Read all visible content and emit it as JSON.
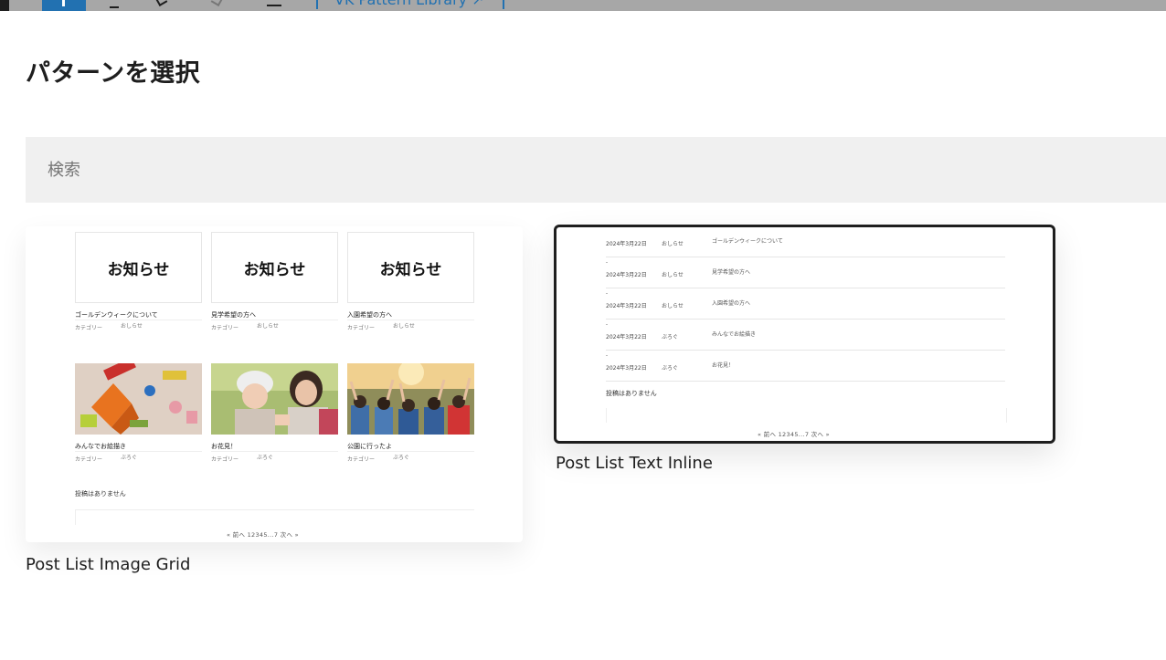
{
  "toolbar": {
    "tab_label": "VK Pattern Library ↗"
  },
  "modal": {
    "title": "パターンを選択"
  },
  "search": {
    "placeholder": "検索"
  },
  "patterns": [
    {
      "label": "Post List Image Grid",
      "thumb_text": "お知らせ",
      "items": [
        {
          "title": "ゴールデンウィークについて",
          "meta_key": "カテゴリー",
          "meta_val": "おしらせ"
        },
        {
          "title": "見学希望の方へ",
          "meta_key": "カテゴリー",
          "meta_val": "おしらせ"
        },
        {
          "title": "入園希望の方へ",
          "meta_key": "カテゴリー",
          "meta_val": "おしらせ"
        },
        {
          "title": "みんなでお絵描き",
          "meta_key": "カテゴリー",
          "meta_val": "ぶろぐ"
        },
        {
          "title": "お花見！",
          "meta_key": "カテゴリー",
          "meta_val": "ぶろぐ"
        },
        {
          "title": "公園に行ったよ",
          "meta_key": "カテゴリー",
          "meta_val": "ぶろぐ"
        }
      ],
      "no_posts": "投稿はありません",
      "pager": "«  前へ   12345...7   次へ  »"
    },
    {
      "label": "Post List Text Inline",
      "rows": [
        {
          "date": "2024年3月22日",
          "cat": "おしらせ",
          "title": "ゴールデンウィークについて"
        },
        {
          "date": "2024年3月22日",
          "cat": "おしらせ",
          "title": "見学希望の方へ"
        },
        {
          "date": "2024年3月22日",
          "cat": "おしらせ",
          "title": "入園希望の方へ"
        },
        {
          "date": "2024年3月22日",
          "cat": "ぶろぐ",
          "title": "みんなでお絵描き"
        },
        {
          "date": "2024年3月22日",
          "cat": "ぶろぐ",
          "title": "お花見！"
        }
      ],
      "no_posts": "投稿はありません",
      "pager": "«  前へ   12345...7   次へ  »"
    }
  ]
}
